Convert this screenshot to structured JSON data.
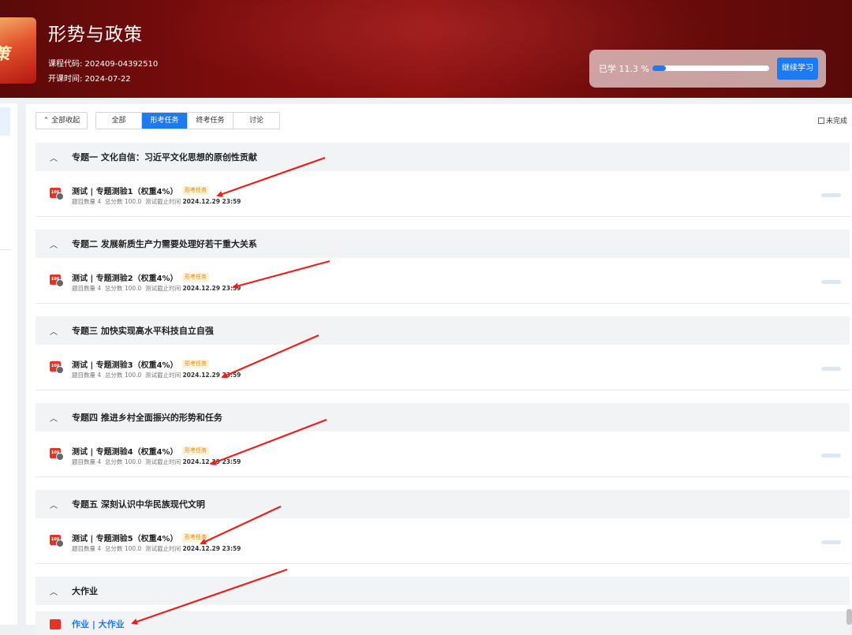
{
  "course": {
    "title": "形势与政策",
    "cover_text": "策",
    "code": "课程代码: 202409-04392510",
    "open_date": "开课时间: 2024-07-22"
  },
  "progress": {
    "label": "已学 11.3 %",
    "value": 0.113,
    "continue_label": "继续学习"
  },
  "toolbar": {
    "collapse_label": "⌃ 全部收起",
    "tabs": [
      {
        "label": "全部",
        "active": false
      },
      {
        "label": "形考任务",
        "active": true
      },
      {
        "label": "终考任务",
        "active": false
      },
      {
        "label": "讨论",
        "active": false
      }
    ],
    "incomplete_label": "未完成"
  },
  "sections": [
    {
      "title": "专题一 文化自信：习近平文化思想的原创性贡献",
      "item": {
        "name": "测试 | 专题测验1（权重4%）",
        "badge": "形考任务",
        "count": "题目数量 4",
        "score": "总分数 100.0",
        "deadline_label": "测试截止时间",
        "deadline": "2024.12.29 23:59"
      }
    },
    {
      "title": "专题二 发展新质生产力需要处理好若干重大关系",
      "item": {
        "name": "测试 | 专题测验2（权重4%）",
        "badge": "形考任务",
        "count": "题目数量 4",
        "score": "总分数 100.0",
        "deadline_label": "测试截止时间",
        "deadline": "2024.12.29 23:59"
      }
    },
    {
      "title": "专题三 加快实现高水平科技自立自强",
      "item": {
        "name": "测试 | 专题测验3（权重4%）",
        "badge": "形考任务",
        "count": "题目数量 4",
        "score": "总分数 100.0",
        "deadline_label": "测试截止时间",
        "deadline": "2024.12.29 23:59"
      }
    },
    {
      "title": "专题四 推进乡村全面振兴的形势和任务",
      "item": {
        "name": "测试 | 专题测验4（权重4%）",
        "badge": "形考任务",
        "count": "题目数量 4",
        "score": "总分数 100.0",
        "deadline_label": "测试截止时间",
        "deadline": "2024.12.29 23:59"
      }
    },
    {
      "title": "专题五 深刻认识中华民族现代文明",
      "item": {
        "name": "测试 | 专题测验5（权重4%）",
        "badge": "形考任务",
        "count": "题目数量 4",
        "score": "总分数 100.0",
        "deadline_label": "测试截止时间",
        "deadline": "2024.12.29 23:59"
      }
    },
    {
      "title": "大作业",
      "item": {
        "name": "作业 | 大作业"
      }
    }
  ],
  "colors": {
    "accent": "#1e7af0",
    "header": "#7a0c0c",
    "annotation_arrow": "#e8211f"
  }
}
